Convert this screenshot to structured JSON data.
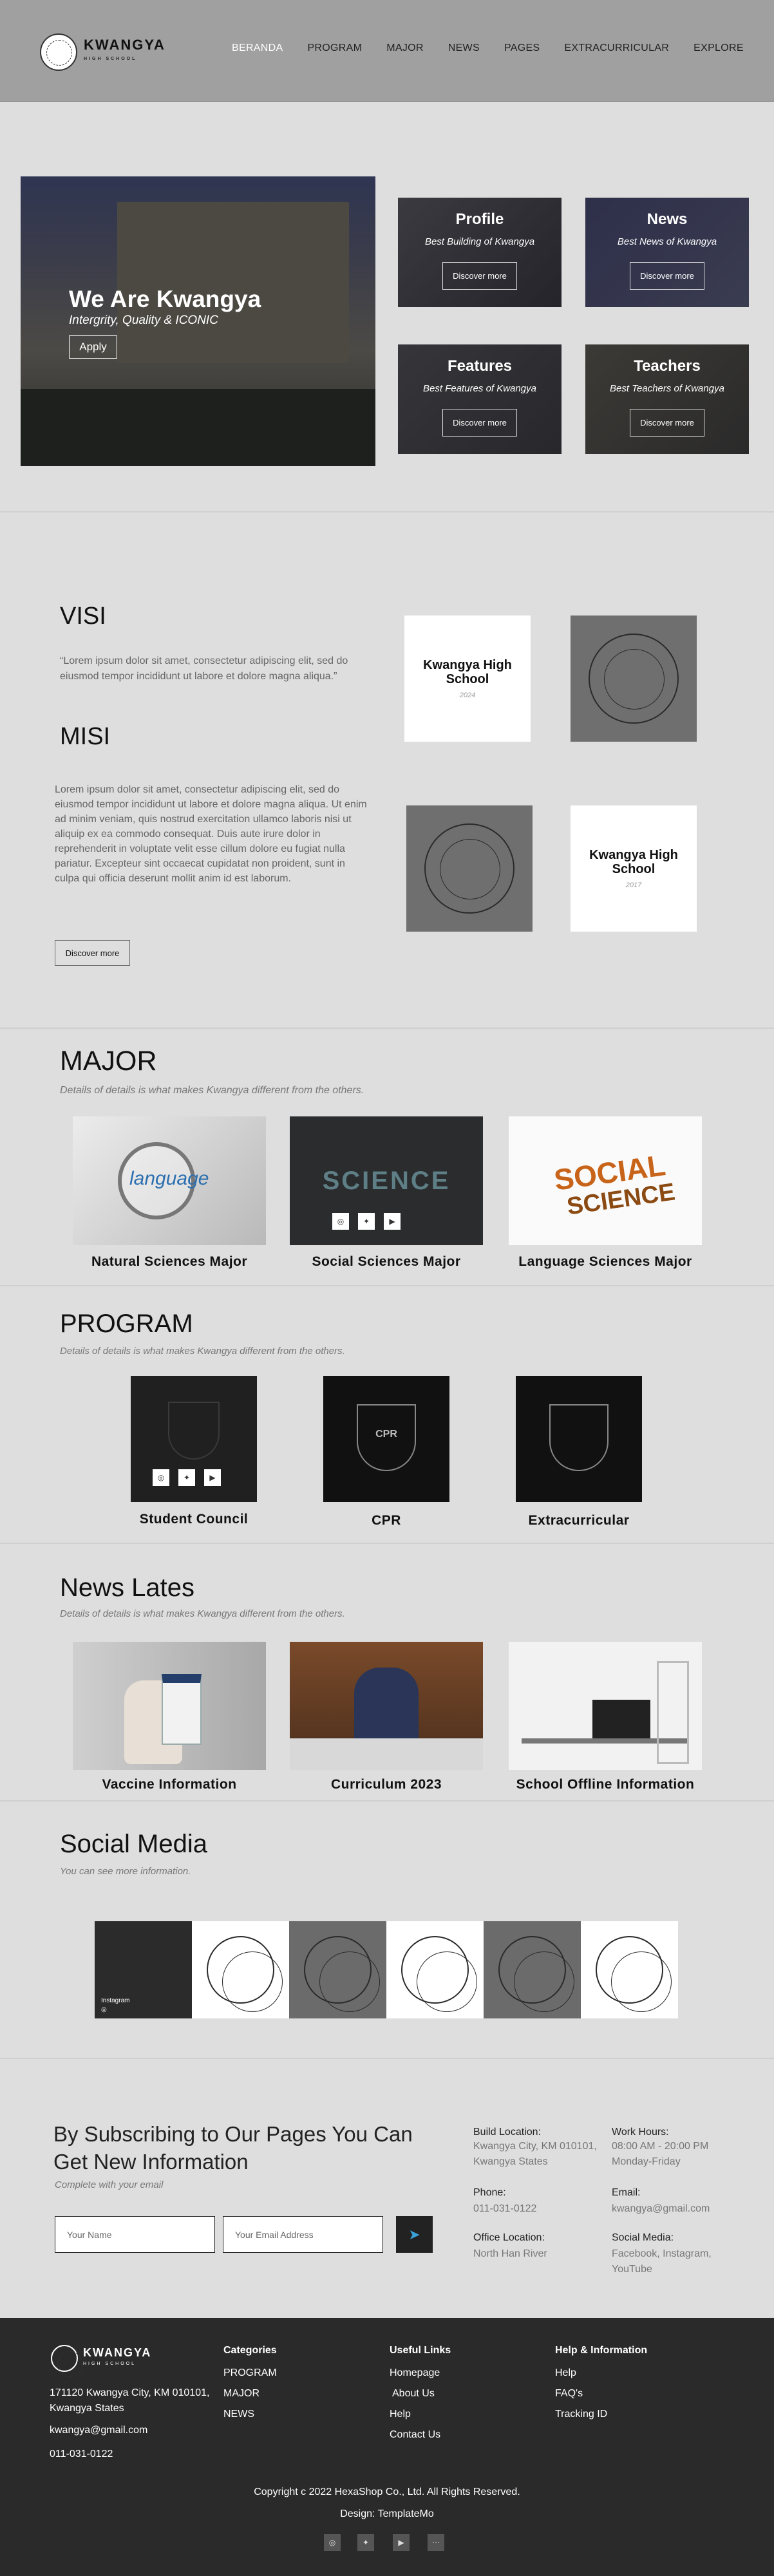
{
  "brand": {
    "name": "KWANGYA",
    "sub": "HIGH SCHOOL"
  },
  "nav": [
    "BERANDA",
    "PROGRAM",
    "MAJOR",
    "NEWS",
    "PAGES",
    "EXTRACURRICULAR",
    "EXPLORE"
  ],
  "hero": {
    "title": "We Are Kwangya",
    "subtitle": "Intergrity, Quality & ICONIC",
    "button": "Apply"
  },
  "cards": [
    {
      "title": "Profile",
      "subtitle": "Best Building of Kwangya",
      "button": "Discover more"
    },
    {
      "title": "News",
      "subtitle": "Best News of Kwangya",
      "button": "Discover more"
    },
    {
      "title": "Features",
      "subtitle": "Best Features of Kwangya",
      "button": "Discover more"
    },
    {
      "title": "Teachers",
      "subtitle": "Best Teachers of Kwangya",
      "button": "Discover more"
    }
  ],
  "visi": {
    "title": "VISI",
    "text": "“Lorem ipsum dolor sit amet, consectetur adipiscing elit, sed do eiusmod tempor incididunt ut labore et dolore magna aliqua.”",
    "misi_title": "MISI",
    "misi_text": "Lorem ipsum dolor sit amet, consectetur adipiscing elit, sed do eiusmod tempor incididunt ut labore et dolore magna aliqua. Ut enim ad minim veniam, quis nostrud exercitation ullamco laboris nisi ut aliquip ex ea commodo consequat. Duis aute irure dolor in reprehenderit in voluptate velit esse cillum dolore eu fugiat nulla pariatur. Excepteur sint occaecat cupidatat non proident, sunt in culpa qui officia deserunt mollit anim id est laborum.",
    "button": "Discover more",
    "tiles": [
      {
        "name": "Kwangya High School",
        "year": "2024"
      },
      {
        "name": "Kwangya High School",
        "year": "2017"
      }
    ]
  },
  "major": {
    "title": "MAJOR",
    "subtitle": "Details of details is what makes Kwangya different from the others.",
    "items": [
      "Natural Sciences Major",
      "Social Sciences Major",
      "Language Sciences Major"
    ],
    "science_word": "SCIENCE",
    "language_word": "language",
    "social_words": [
      "SOCIAL",
      "SCIENCE"
    ]
  },
  "program": {
    "title": "PROGRAM",
    "subtitle": "Details of details is what makes Kwangya different from the others.",
    "items": [
      "Student Council",
      "CPR",
      "Extracurricular"
    ],
    "badge_text": "CPR"
  },
  "news": {
    "title": "News Lates",
    "subtitle": "Details of details is what makes Kwangya different from the others.",
    "items": [
      "Vaccine Information",
      "Curriculum 2023",
      "School Offline Information"
    ]
  },
  "social": {
    "title": "Social Media",
    "subtitle": "You can see more information.",
    "instagram_label": "Instagram"
  },
  "subscribe": {
    "title": "By Subscribing to Our Pages You Can Get New Information",
    "subtitle": "Complete with your email",
    "name_placeholder": "Your Name",
    "email_placeholder": "Your Email Address",
    "info": [
      {
        "label": "Build Location:",
        "value": "Kwangya City, KM 010101, Kwangya States"
      },
      {
        "label": "Work Hours:",
        "value": "08:00 AM - 20:00 PM Monday-Friday"
      },
      {
        "label": "Phone:",
        "value": "011-031-0122"
      },
      {
        "label": "Email:",
        "value": "kwangya@gmail.com"
      },
      {
        "label": "Office Location:",
        "value": "North Han River"
      },
      {
        "label": "Social Media:",
        "value": "Facebook, Instagram, YouTube"
      }
    ]
  },
  "footer": {
    "address": "171120 Kwangya City, KM 010101, Kwangya States",
    "email": "kwangya@gmail.com",
    "phone": "011-031-0122",
    "columns": [
      {
        "title": "Categories",
        "links": [
          "PROGRAM",
          "MAJOR",
          "NEWS"
        ]
      },
      {
        "title": "Useful Links",
        "links": [
          "Homepage",
          "About Us",
          "Help",
          "Contact Us"
        ]
      },
      {
        "title": "Help & Information",
        "links": [
          "Help",
          "FAQ's",
          "Tracking ID"
        ]
      }
    ],
    "copyright": "Copyright c 2022 HexaShop Co., Ltd. All Rights Reserved.",
    "design": "Design: TemplateMo"
  },
  "icons": [
    "instagram-icon",
    "twitter-icon",
    "youtube-icon",
    "more-icon"
  ],
  "colors": {
    "nav_bg": "#a0a0a0",
    "page_bg": "#dedede",
    "footer_bg": "#2a2a2a",
    "active_nav": "#ffffff"
  }
}
